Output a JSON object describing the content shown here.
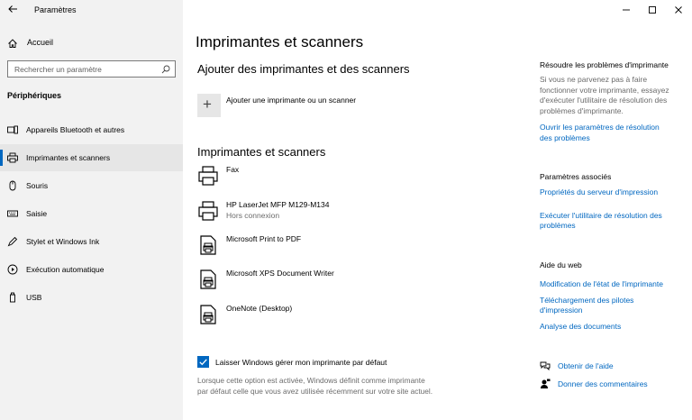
{
  "window": {
    "title": "Paramètres"
  },
  "sidebar": {
    "home_label": "Accueil",
    "search_placeholder": "Rechercher un paramètre",
    "section": "Périphériques",
    "items": [
      {
        "label": "Appareils Bluetooth et autres",
        "icon": "bluetooth-devices-icon",
        "active": false
      },
      {
        "label": "Imprimantes et scanners",
        "icon": "printer-icon",
        "active": true
      },
      {
        "label": "Souris",
        "icon": "mouse-icon",
        "active": false
      },
      {
        "label": "Saisie",
        "icon": "keyboard-icon",
        "active": false
      },
      {
        "label": "Stylet et Windows Ink",
        "icon": "pen-icon",
        "active": false
      },
      {
        "label": "Exécution automatique",
        "icon": "autoplay-icon",
        "active": false
      },
      {
        "label": "USB",
        "icon": "usb-icon",
        "active": false
      }
    ]
  },
  "main": {
    "title": "Imprimantes et scanners",
    "add_section_title": "Ajouter des imprimantes et des scanners",
    "add_label": "Ajouter une imprimante ou un scanner",
    "list_title": "Imprimantes et scanners",
    "printers": [
      {
        "name": "Fax",
        "status": "",
        "icon": "fax-icon"
      },
      {
        "name": "HP LaserJet MFP M129-M134",
        "status": "Hors connexion",
        "icon": "printer-icon"
      },
      {
        "name": "Microsoft Print to PDF",
        "status": "",
        "icon": "document-printer-icon"
      },
      {
        "name": "Microsoft XPS Document Writer",
        "status": "",
        "icon": "document-printer-icon"
      },
      {
        "name": "OneNote (Desktop)",
        "status": "",
        "icon": "document-printer-icon"
      }
    ],
    "default_printer": {
      "checked": true,
      "label": "Laisser Windows gérer mon imprimante par défaut",
      "description_line1": "Lorsque cette option est activée, Windows définit comme imprimante",
      "description_line2": "par défaut celle que vous avez utilisée récemment sur votre site actuel."
    }
  },
  "right": {
    "troubleshoot": {
      "heading": "Résoudre les problèmes d'imprimante",
      "text_lines": [
        "Si vous ne parvenez pas à faire",
        "fonctionner votre imprimante, essayez",
        "d'exécuter l'utilitaire de résolution des",
        "problèmes d'imprimante."
      ],
      "link_lines": [
        "Ouvrir les paramètres de résolution",
        "des problèmes"
      ]
    },
    "related": {
      "heading": "Paramètres associés",
      "link1": "Propriétés du serveur d'impression",
      "link2_lines": [
        "Exécuter l'utilitaire de résolution des",
        "problèmes"
      ]
    },
    "web_help": {
      "heading": "Aide du web",
      "link1": "Modification de l'état de l'imprimante",
      "link2_lines": [
        "Téléchargement des pilotes",
        "d'impression"
      ],
      "link3": "Analyse des documents"
    },
    "get_help": "Obtenir de l'aide",
    "feedback": "Donner des commentaires"
  },
  "colors": {
    "accent": "#0067c0",
    "sidebar_bg": "#f2f2f2"
  }
}
